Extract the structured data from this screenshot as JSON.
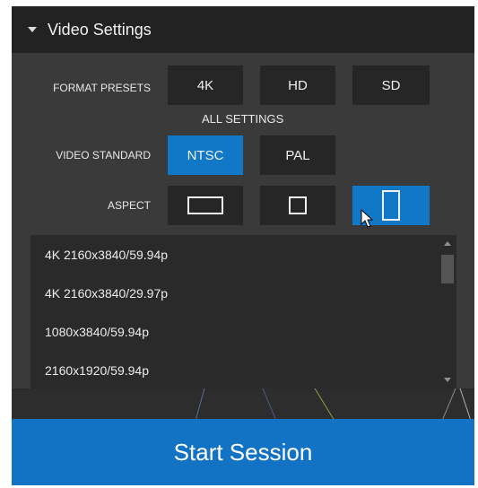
{
  "panel": {
    "title": "Video Settings"
  },
  "format_presets": {
    "label": "FORMAT PRESETS",
    "options": [
      "4K",
      "HD",
      "SD"
    ]
  },
  "all_settings_label": "ALL SETTINGS",
  "video_standard": {
    "label": "VIDEO STANDARD",
    "options": [
      "NTSC",
      "PAL"
    ],
    "selected": "NTSC"
  },
  "aspect": {
    "label": "ASPECT",
    "options": [
      "aspect-wide-icon",
      "aspect-square-icon",
      "aspect-tall-icon"
    ],
    "selected": "aspect-tall-icon"
  },
  "resolution_list": {
    "items": [
      "4K 2160x3840/59.94p",
      "4K 2160x3840/29.97p",
      "1080x3840/59.94p",
      "2160x1920/59.94p"
    ]
  },
  "start_button": {
    "label": "Start Session"
  },
  "colors": {
    "accent": "#1273c5",
    "panel_bg": "#3a3a3a",
    "header_bg": "#222222",
    "button_bg": "#262626"
  }
}
